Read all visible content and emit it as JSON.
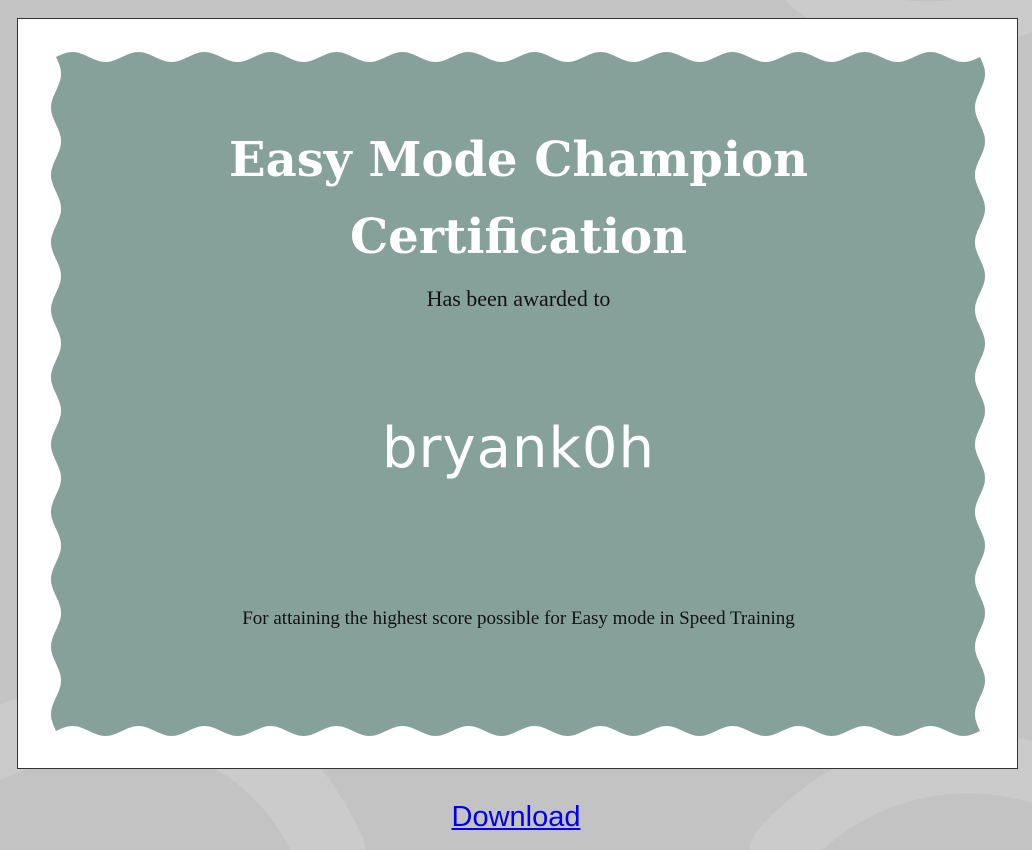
{
  "certificate": {
    "title_line1": "Easy Mode Champion",
    "title_line2": "Certification",
    "subtitle": "Has been awarded to",
    "recipient": "bryank0h",
    "reason": "For attaining the highest score possible for Easy mode in Speed Training"
  },
  "actions": {
    "download_label": "Download"
  },
  "colors": {
    "page_background": "#c3c3c3",
    "frame_background": "#ffffff",
    "panel_fill": "#86a19a",
    "title_text": "#ffffff",
    "body_text": "#111111",
    "link": "#0000ee"
  }
}
